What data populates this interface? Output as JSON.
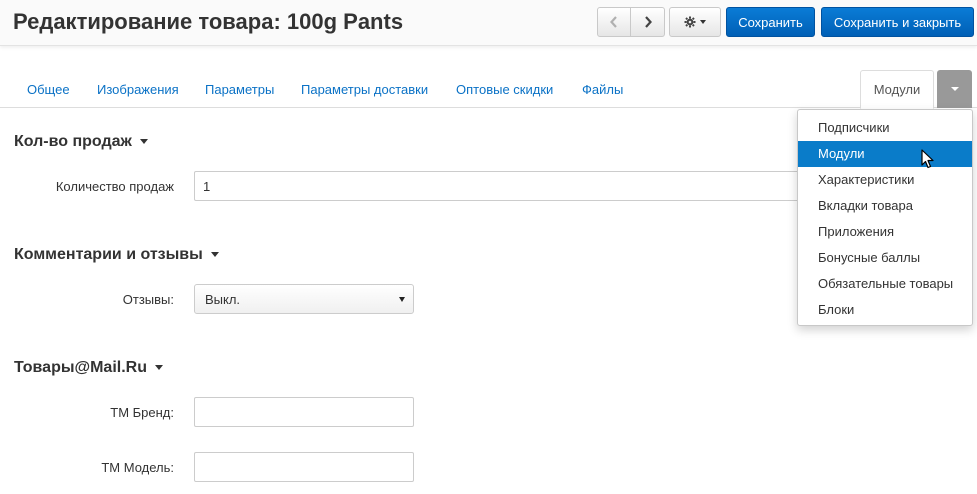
{
  "header": {
    "title": "Редактирование товара: 100g Pants",
    "save_label": "Сохранить",
    "save_close_label": "Сохранить и закрыть"
  },
  "tabs": [
    {
      "label": "Общее"
    },
    {
      "label": "Изображения"
    },
    {
      "label": "Параметры"
    },
    {
      "label": "Параметры доставки"
    },
    {
      "label": "Оптовые скидки"
    },
    {
      "label": "Файлы"
    }
  ],
  "active_tab": {
    "label": "Модули"
  },
  "dropdown": {
    "items": [
      {
        "label": "Подписчики"
      },
      {
        "label": "Модули"
      },
      {
        "label": "Характеристики"
      },
      {
        "label": "Вкладки товара"
      },
      {
        "label": "Приложения"
      },
      {
        "label": "Бонусные баллы"
      },
      {
        "label": "Обязательные товары"
      },
      {
        "label": "Блоки"
      }
    ],
    "highlighted": "Модули"
  },
  "sections": {
    "sales": {
      "title": "Кол-во продаж",
      "field_label": "Количество продаж",
      "field_value": "1"
    },
    "reviews": {
      "title": "Комментарии и отзывы",
      "field_label": "Отзывы:",
      "field_value": "Выкл."
    },
    "mailru": {
      "title": "Товары@Mail.Ru",
      "brand_label": "ТМ Бренд:",
      "brand_value": "",
      "model_label": "ТМ Модель:",
      "model_value": ""
    }
  },
  "colors": {
    "primary": "#0a7cd6",
    "link": "#0b72c6",
    "menu_highlight": "#0a7cc9"
  }
}
